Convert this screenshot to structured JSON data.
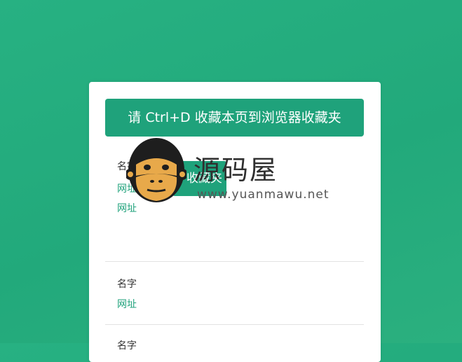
{
  "banner": {
    "text": "请 Ctrl+D 收藏本页到浏览器收藏夹"
  },
  "entries": [
    {
      "name": "名字",
      "url": "网址"
    },
    {
      "name": "名字",
      "url": "网址"
    },
    {
      "name": "名字",
      "url": "网址"
    }
  ],
  "favorite_button": {
    "label": "收藏夹"
  },
  "watermark": {
    "brand": "源码屋",
    "site": "www.yuanmawu.net",
    "logo_icon": "monkey-face-icon"
  },
  "colors": {
    "accent": "#1fa27b",
    "background": "#26ae80"
  }
}
